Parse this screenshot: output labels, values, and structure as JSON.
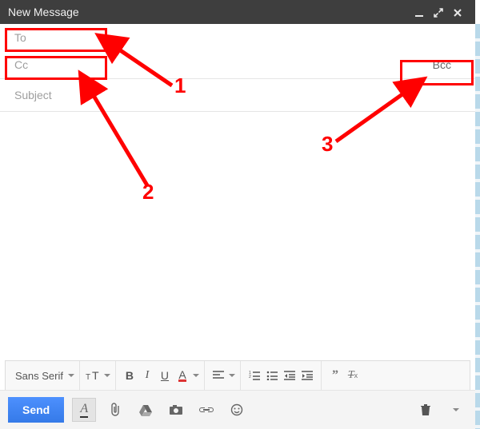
{
  "header": {
    "title": "New Message"
  },
  "fields": {
    "to_placeholder": "To",
    "cc_placeholder": "Cc",
    "bcc_label": "Bcc",
    "subject_placeholder": "Subject"
  },
  "body": {
    "text": ""
  },
  "format_toolbar": {
    "font_family": "Sans Serif"
  },
  "actions": {
    "send_label": "Send"
  },
  "annotations": {
    "n1": "1",
    "n2": "2",
    "n3": "3"
  },
  "colors": {
    "annotation": "#ff0000",
    "send_button": "#357ae8",
    "titlebar": "#3e3e3e"
  }
}
